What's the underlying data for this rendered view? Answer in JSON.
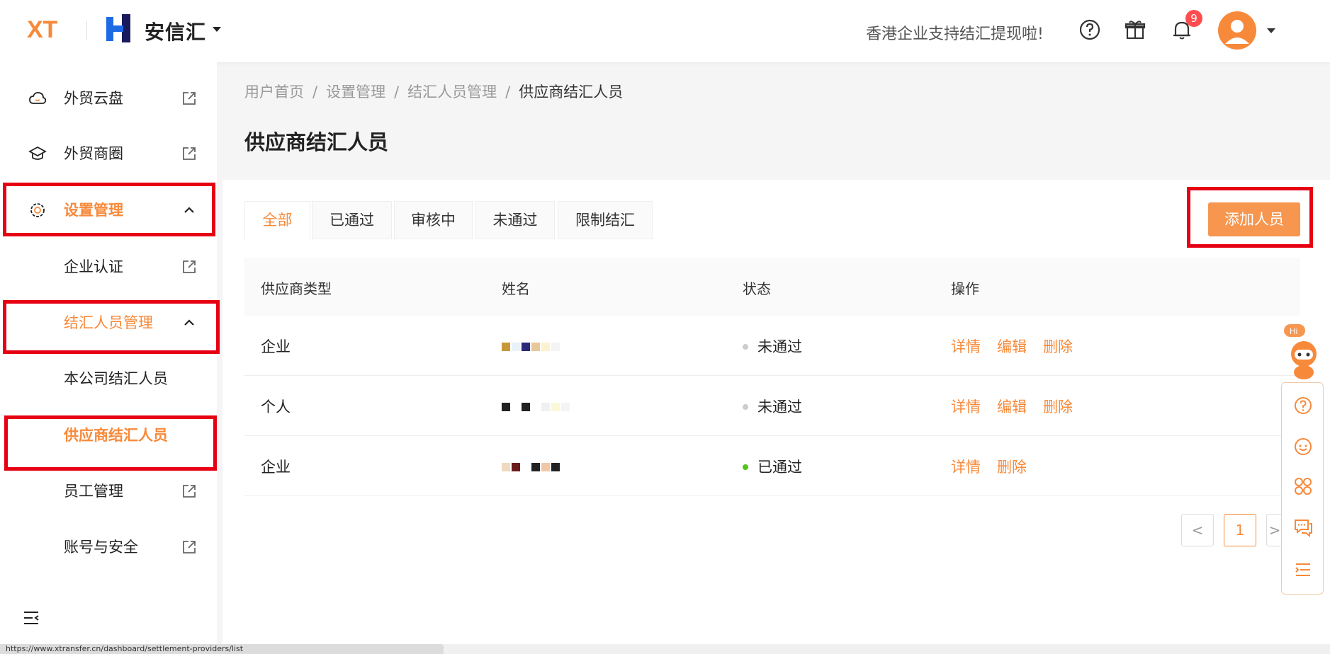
{
  "header": {
    "logo_text": "XT",
    "brand_name": "安信汇",
    "promo_text": "香港企业支持结汇提现啦!",
    "notification_count": "9",
    "accent_color": "#f7893a"
  },
  "sidebar": {
    "items": [
      {
        "label": "外贸云盘",
        "icon": "cloud-icon",
        "external": true
      },
      {
        "label": "外贸商圈",
        "icon": "graduation-cap-icon",
        "external": true
      },
      {
        "label": "设置管理",
        "icon": "gear-icon",
        "expanded": true
      },
      {
        "label": "企业认证",
        "external": true
      },
      {
        "label": "结汇人员管理",
        "expanded": true
      },
      {
        "label": "本公司结汇人员"
      },
      {
        "label": "供应商结汇人员",
        "selected": true
      },
      {
        "label": "员工管理",
        "external": true
      },
      {
        "label": "账号与安全",
        "external": true
      }
    ]
  },
  "breadcrumb": [
    "用户首页",
    "设置管理",
    "结汇人员管理",
    "供应商结汇人员"
  ],
  "page_title": "供应商结汇人员",
  "tabs": [
    "全部",
    "已通过",
    "审核中",
    "未通过",
    "限制结汇"
  ],
  "active_tab": "全部",
  "add_button": "添加人员",
  "table": {
    "columns": [
      "供应商类型",
      "姓名",
      "状态",
      "操作"
    ],
    "rows": [
      {
        "type": "企业",
        "status": "未通过",
        "status_color": "#cccccc",
        "actions": [
          "详情",
          "编辑",
          "删除"
        ]
      },
      {
        "type": "个人",
        "status": "未通过",
        "status_color": "#cccccc",
        "actions": [
          "详情",
          "编辑",
          "删除"
        ]
      },
      {
        "type": "企业",
        "status": "已通过",
        "status_color": "#52c41a",
        "actions": [
          "详情",
          "删除"
        ]
      }
    ]
  },
  "pagination": {
    "current_page": "1",
    "prev": "<",
    "next": ">"
  },
  "float_widget": {
    "hi_text": "Hi"
  },
  "status_bar_url": "https://www.xtransfer.cn/dashboard/settlement-providers/list"
}
